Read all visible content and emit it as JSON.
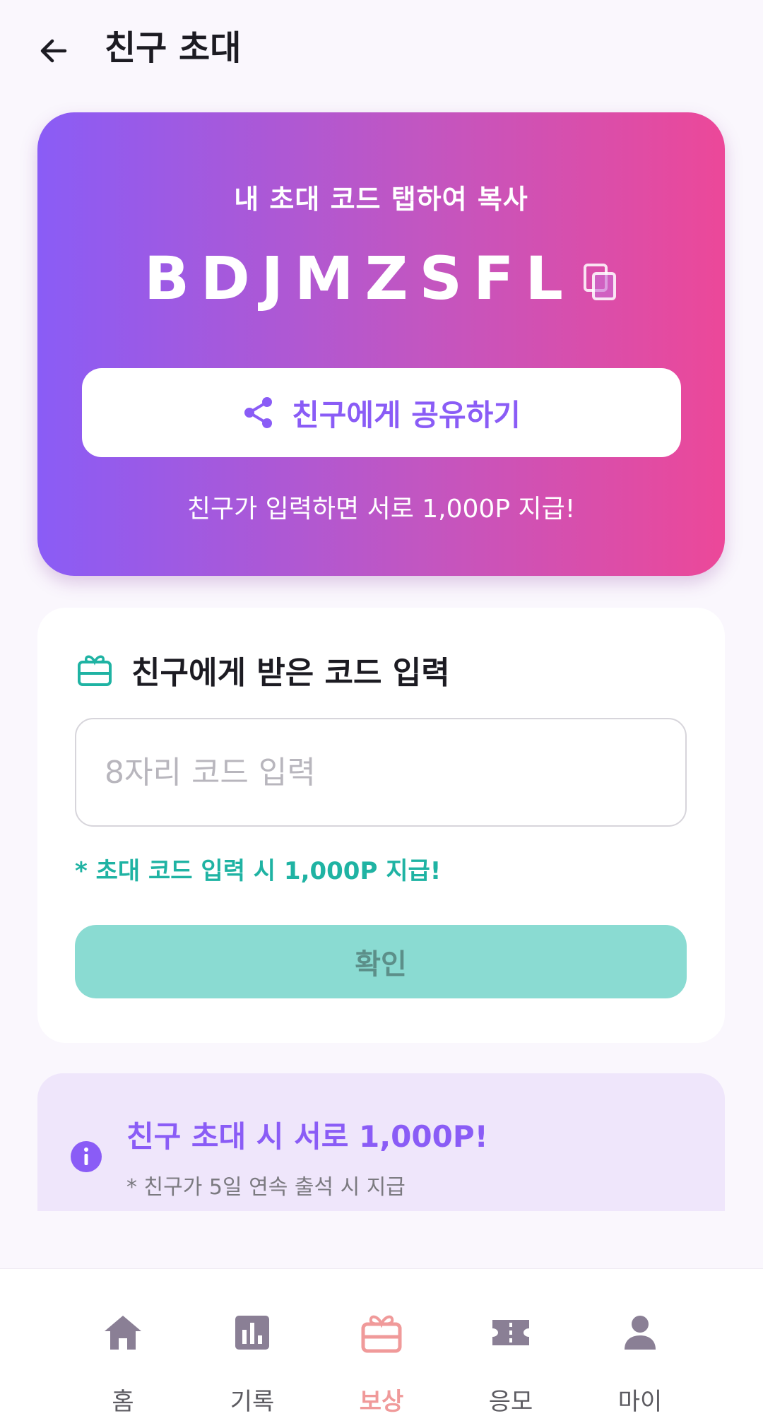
{
  "header": {
    "title": "친구 초대"
  },
  "invite_card": {
    "label": "내 초대 코드 탭하여 복사",
    "code": "BDJMZSFL",
    "share_button_label": "친구에게 공유하기",
    "reward_note": "친구가 입력하면 서로 1,000P 지급!",
    "gradient_colors": [
      "#8a5cf6",
      "#ec4899"
    ]
  },
  "code_entry": {
    "title": "친구에게 받은 코드 입력",
    "input_placeholder": "8자리 코드 입력",
    "input_value": "",
    "hint": "* 초대 코드 입력 시 1,000P 지급!",
    "confirm_label": "확인"
  },
  "info_banner": {
    "title": "친구 초대 시 서로 1,000P!",
    "subtitle": "* 친구가 5일 연속 출석 시 지급"
  },
  "bottom_nav": {
    "items": [
      {
        "label": "홈",
        "icon": "home-icon",
        "active": false
      },
      {
        "label": "기록",
        "icon": "chart-icon",
        "active": false
      },
      {
        "label": "보상",
        "icon": "gift-icon",
        "active": true
      },
      {
        "label": "응모",
        "icon": "ticket-icon",
        "active": false
      },
      {
        "label": "마이",
        "icon": "person-icon",
        "active": false
      }
    ]
  },
  "colors": {
    "accent_purple": "#8a5cf6",
    "accent_pink": "#ec4899",
    "teal": "#1fb3a3",
    "confirm_disabled": "#8adbd2",
    "nav_active": "#f09a9a"
  }
}
